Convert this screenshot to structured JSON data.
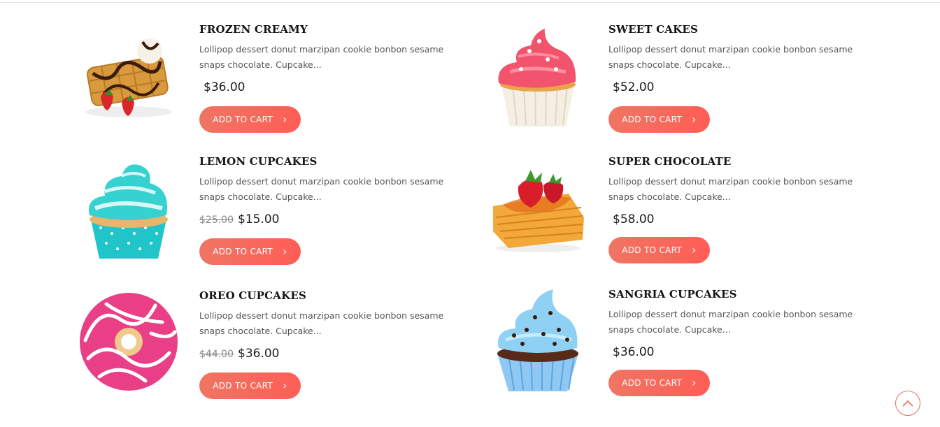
{
  "products": [
    {
      "title": "FROZEN CREAMY",
      "description": "Lollipop dessert donut marzipan cookie bonbon sesame snaps chocolate. Cupcake...",
      "old_price": "",
      "price": "$36.00",
      "button": "ADD TO CART",
      "image_icon": "waffle-image"
    },
    {
      "title": "SWEET CAKES",
      "description": "Lollipop dessert donut marzipan cookie bonbon sesame snaps chocolate. Cupcake...",
      "old_price": "",
      "price": "$52.00",
      "button": "ADD TO CART",
      "image_icon": "pink-cupcake-image"
    },
    {
      "title": "LEMON CUPCAKES",
      "description": "Lollipop dessert donut marzipan cookie bonbon sesame snaps chocolate. Cupcake...",
      "old_price": "$25.00",
      "price": "$15.00",
      "button": "ADD TO CART",
      "image_icon": "teal-cupcake-image"
    },
    {
      "title": "SUPER CHOCOLATE",
      "description": "Lollipop dessert donut marzipan cookie bonbon sesame snaps chocolate. Cupcake...",
      "old_price": "",
      "price": "$58.00",
      "button": "ADD TO CART",
      "image_icon": "strawberry-pastry-image"
    },
    {
      "title": "OREO CUPCAKES",
      "description": "Lollipop dessert donut marzipan cookie bonbon sesame snaps chocolate. Cupcake...",
      "old_price": "$44.00",
      "price": "$36.00",
      "button": "ADD TO CART",
      "image_icon": "pink-donut-image"
    },
    {
      "title": "SANGRIA CUPCAKES",
      "description": "Lollipop dessert donut marzipan cookie bonbon sesame snaps chocolate. Cupcake...",
      "old_price": "",
      "price": "$36.00",
      "button": "ADD TO CART",
      "image_icon": "blue-cupcake-image"
    }
  ],
  "colors": {
    "accent": "#f4685a",
    "accent_end": "#ff5d55",
    "title": "#151515",
    "text": "#555555"
  },
  "scroll_top_icon": "chevron-up-icon"
}
